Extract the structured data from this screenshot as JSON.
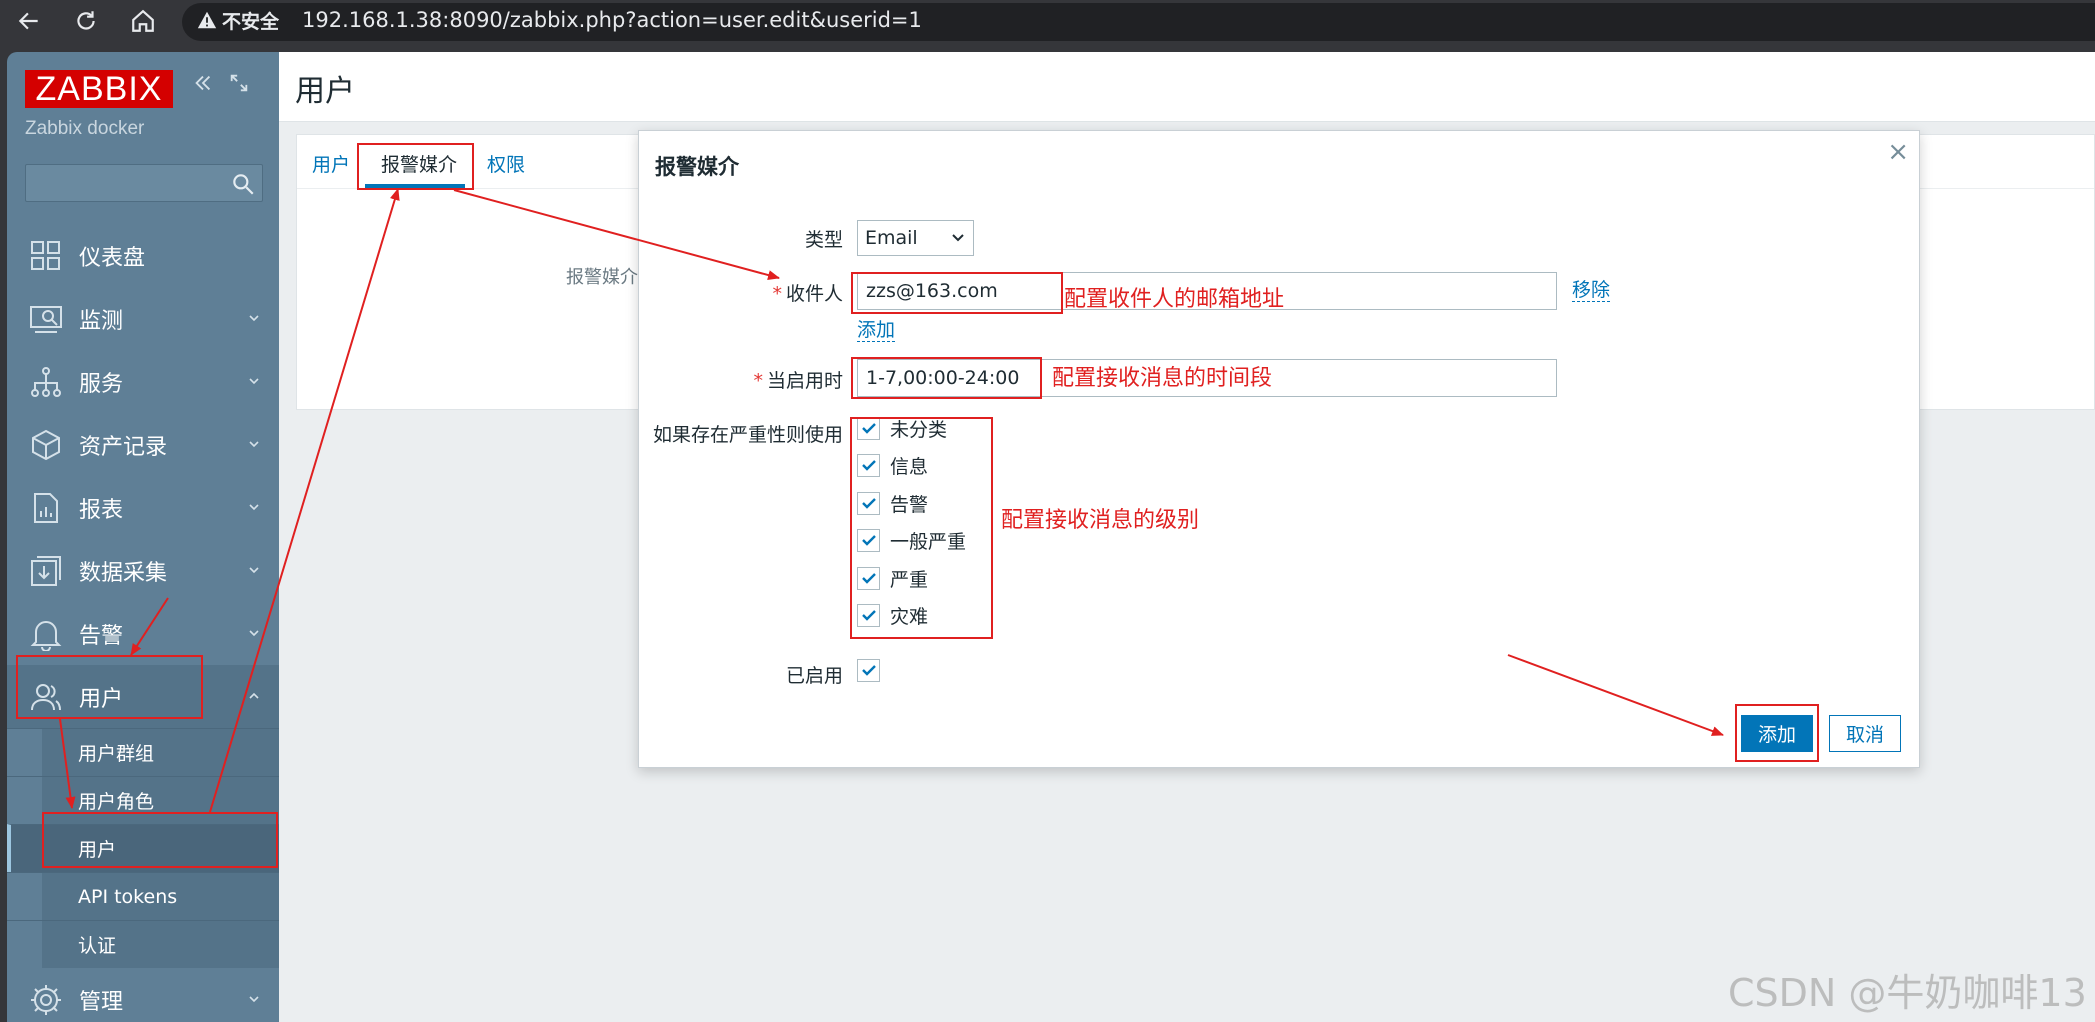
{
  "browser": {
    "security_label": "不安全",
    "url": "192.168.1.38:8090/zabbix.php?action=user.edit&userid=1"
  },
  "sidebar": {
    "logo": "ZABBIX",
    "server_name": "Zabbix docker",
    "search_placeholder": "",
    "items": [
      {
        "label": "仪表盘",
        "icon": "dashboard-icon"
      },
      {
        "label": "监测",
        "icon": "monitoring-icon"
      },
      {
        "label": "服务",
        "icon": "services-icon"
      },
      {
        "label": "资产记录",
        "icon": "inventory-icon"
      },
      {
        "label": "报表",
        "icon": "reports-icon"
      },
      {
        "label": "数据采集",
        "icon": "data-collection-icon"
      },
      {
        "label": "告警",
        "icon": "alerts-icon"
      },
      {
        "label": "用户",
        "icon": "users-icon"
      },
      {
        "label": "管理",
        "icon": "administration-icon"
      }
    ],
    "user_submenu": [
      "用户群组",
      "用户角色",
      "用户",
      "API tokens",
      "认证"
    ],
    "active_subitem": "用户"
  },
  "page": {
    "title": "用户",
    "tabs": [
      "用户",
      "报警媒介",
      "权限"
    ],
    "active_tab": "报警媒介",
    "background_field_label": "报警媒介"
  },
  "modal": {
    "title": "报警媒介",
    "close": "×",
    "type_label": "类型",
    "type_value": "Email",
    "recipient_label": "收件人",
    "recipient_value": "zzs@163.com",
    "remove_link": "移除",
    "add_link": "添加",
    "when_active_label": "当启用时",
    "when_active_value": "1-7,00:00-24:00",
    "severity_label": "如果存在严重性则使用",
    "severities": [
      {
        "label": "未分类",
        "checked": true
      },
      {
        "label": "信息",
        "checked": true
      },
      {
        "label": "告警",
        "checked": true
      },
      {
        "label": "一般严重",
        "checked": true
      },
      {
        "label": "严重",
        "checked": true
      },
      {
        "label": "灾难",
        "checked": true
      }
    ],
    "enabled_label": "已启用",
    "enabled": true,
    "add_button": "添加",
    "cancel_button": "取消"
  },
  "annotations": {
    "recipient_note": "配置收件人的邮箱地址",
    "time_note": "配置接收消息的时间段",
    "severity_note": "配置接收消息的级别",
    "annotation_color": "#e02020"
  },
  "watermark": "CSDN @牛奶咖啡13",
  "colors": {
    "sidebar_bg": "#5f7f96",
    "logo_bg": "#d40000",
    "link": "#0275b8",
    "primary_button": "#0275b8"
  }
}
